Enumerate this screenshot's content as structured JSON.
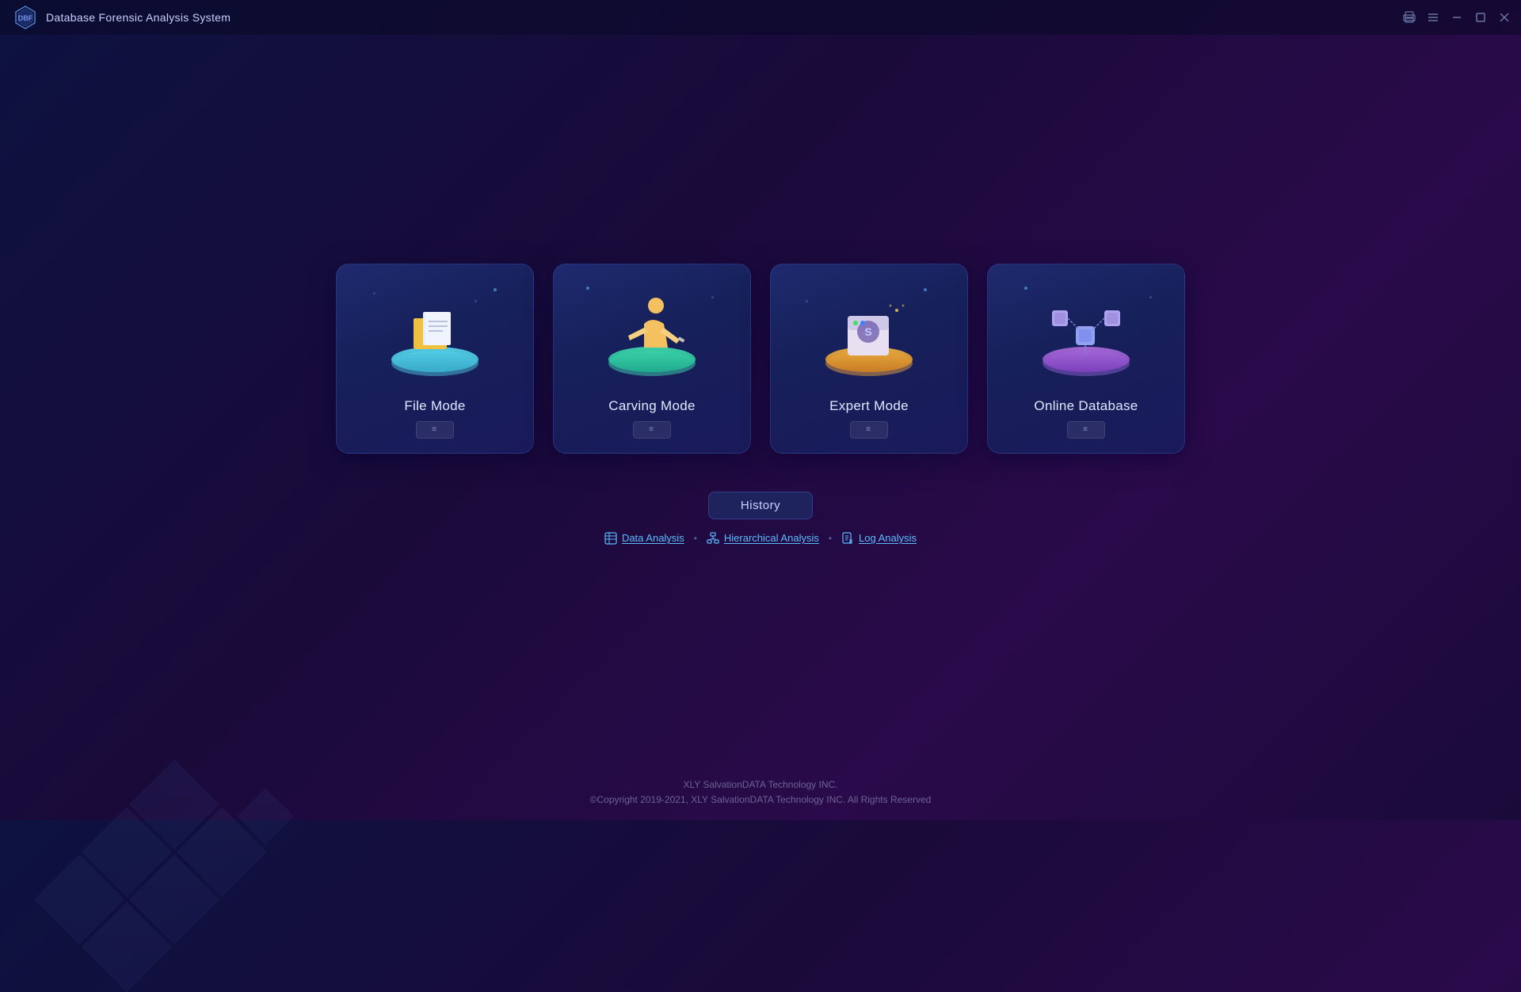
{
  "app": {
    "logo_text": "DBF",
    "title": "Database Forensic Analysis System"
  },
  "titlebar": {
    "controls": {
      "print": "🖨",
      "menu": "≡",
      "minimize": "—",
      "maximize": "❐",
      "close": "✕"
    }
  },
  "cards": [
    {
      "id": "file-mode",
      "label": "File Mode",
      "icon_type": "file-mode-icon"
    },
    {
      "id": "carving-mode",
      "label": "Carving Mode",
      "icon_type": "carving-icon"
    },
    {
      "id": "expert-mode",
      "label": "Expert Mode",
      "icon_type": "expert-icon"
    },
    {
      "id": "online-database",
      "label": "Online Database",
      "icon_type": "online-db-icon"
    }
  ],
  "history": {
    "button_label": "History",
    "links": [
      {
        "id": "data-analysis",
        "label": "Data Analysis",
        "icon": "table-icon"
      },
      {
        "id": "hierarchical-analysis",
        "label": "Hierarchical Analysis",
        "icon": "hierarchy-icon"
      },
      {
        "id": "log-analysis",
        "label": "Log Analysis",
        "icon": "log-icon"
      }
    ]
  },
  "footer": {
    "line1": "XLY SalvationDATA Technology INC.",
    "line2": "©Copyright 2019-2021, XLY SalvationDATA Technology INC. All Rights Reserved"
  }
}
